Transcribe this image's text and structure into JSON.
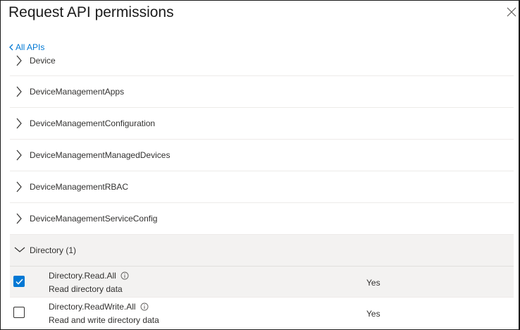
{
  "panel": {
    "title": "Request API permissions",
    "back_label": "All APIs"
  },
  "categories": [
    {
      "label": "Device"
    },
    {
      "label": "DeviceManagementApps"
    },
    {
      "label": "DeviceManagementConfiguration"
    },
    {
      "label": "DeviceManagementManagedDevices"
    },
    {
      "label": "DeviceManagementRBAC"
    },
    {
      "label": "DeviceManagementServiceConfig"
    }
  ],
  "directory": {
    "label": "Directory (1)",
    "permissions": [
      {
        "name": "Directory.Read.All",
        "description": "Read directory data",
        "admin_consent": "Yes",
        "checked": true
      },
      {
        "name": "Directory.ReadWrite.All",
        "description": "Read and write directory data",
        "admin_consent": "Yes",
        "checked": false
      }
    ]
  },
  "colors": {
    "accent": "#0078d4",
    "selected_bg": "#f3f2f1"
  },
  "icons": {
    "close": "close-icon",
    "back": "chevron-left-icon",
    "collapsed": "chevron-right-icon",
    "expanded": "chevron-down-icon",
    "info": "info-icon",
    "check": "checkmark-icon"
  }
}
